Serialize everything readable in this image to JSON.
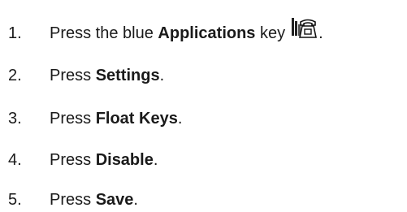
{
  "steps": [
    {
      "number": "1.",
      "prefix": "Press the blue ",
      "bold": "Applications",
      "suffix": " key",
      "icon": "desk-phone-icon",
      "end": "."
    },
    {
      "number": "2.",
      "prefix": "Press ",
      "bold": "Settings",
      "suffix": "."
    },
    {
      "number": "3.",
      "prefix": "Press ",
      "bold": "Float Keys",
      "suffix": "."
    },
    {
      "number": "4.",
      "prefix": "Press ",
      "bold": "Disable",
      "suffix": "."
    },
    {
      "number": "5.",
      "prefix": "Press ",
      "bold": "Save",
      "suffix": "."
    }
  ]
}
